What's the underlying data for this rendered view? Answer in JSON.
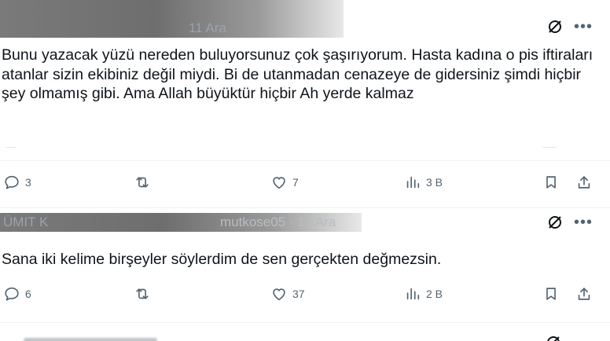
{
  "tweets": [
    {
      "header_visible": "11 Ara",
      "text": "Bunu yazacak yüzü nereden buluyorsunuz çok şaşırıyorum. Hasta kadına o pis iftiraları atanlar sizin ekibiniz değil miydi. Bi de utanmadan cenazeye de gidersiniz şimdi hiçbir şey olmamış gibi. Ama Allah büyüktür hiçbir Ah yerde kalmaz",
      "stats": {
        "replies": "3",
        "likes": "7",
        "views": "3 B"
      }
    },
    {
      "header_visible": "ÜMIT K",
      "handle_time": "mutkose05 · 14 Ara",
      "text": "Sana iki kelime birşeyler söylerdim de sen gerçekten değmezsin.",
      "stats": {
        "replies": "6",
        "likes": "37",
        "views": "2 B"
      }
    }
  ],
  "icons": {
    "reply": "reply-icon",
    "retweet": "retweet-icon",
    "like": "like-icon",
    "views": "views-icon",
    "bookmark": "bookmark-icon",
    "share": "share-icon",
    "grok": "grok-icon",
    "more": "more-icon"
  }
}
